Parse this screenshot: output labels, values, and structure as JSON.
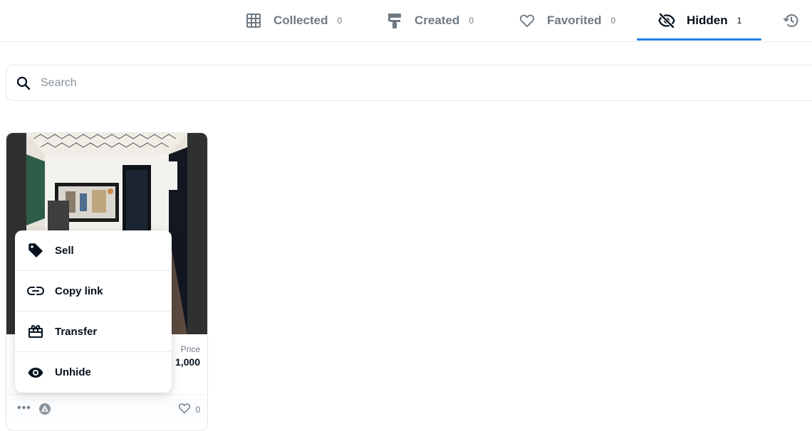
{
  "tabs": [
    {
      "label": "Collected",
      "count": "0",
      "icon": "grid-icon"
    },
    {
      "label": "Created",
      "count": "0",
      "icon": "brush-icon"
    },
    {
      "label": "Favorited",
      "count": "0",
      "icon": "heart-icon"
    },
    {
      "label": "Hidden",
      "count": "1",
      "icon": "eye-off-icon",
      "active": true
    },
    {
      "label": "",
      "count": "",
      "icon": "history-icon"
    }
  ],
  "search": {
    "placeholder": "Search"
  },
  "card": {
    "price_label": "Price",
    "price_value": "1,000",
    "favorite_count": "0"
  },
  "menu": {
    "items": [
      {
        "label": "Sell",
        "icon": "tag-icon"
      },
      {
        "label": "Copy link",
        "icon": "link-icon"
      },
      {
        "label": "Transfer",
        "icon": "gift-icon"
      },
      {
        "label": "Unhide",
        "icon": "eye-icon"
      }
    ]
  },
  "colors": {
    "accent": "#2081e2",
    "text": "#04111d",
    "muted": "#707a83",
    "border": "#e5e8eb"
  }
}
